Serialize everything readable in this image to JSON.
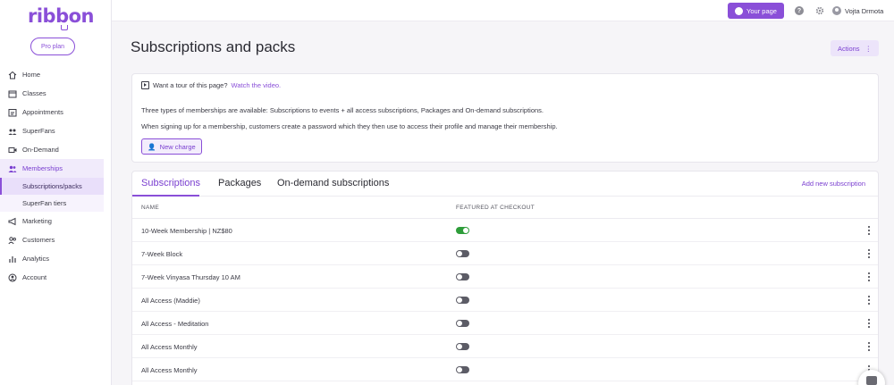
{
  "brand": {
    "logo": "ribbon",
    "accent": "#8a4fd8",
    "plan_label": "Pro plan"
  },
  "topbar": {
    "your_page_label": "Your page",
    "user_name": "Vojta Drmota"
  },
  "sidebar": {
    "items": [
      {
        "label": "Home",
        "icon": "home-icon"
      },
      {
        "label": "Classes",
        "icon": "calendar-icon"
      },
      {
        "label": "Appointments",
        "icon": "appointments-icon"
      },
      {
        "label": "SuperFans",
        "icon": "superfans-icon"
      },
      {
        "label": "On-Demand",
        "icon": "video-icon"
      },
      {
        "label": "Memberships",
        "icon": "members-icon",
        "active": true
      },
      {
        "label": "Marketing",
        "icon": "megaphone-icon"
      },
      {
        "label": "Customers",
        "icon": "customers-icon"
      },
      {
        "label": "Analytics",
        "icon": "analytics-icon"
      },
      {
        "label": "Account",
        "icon": "account-icon"
      }
    ],
    "sub_items": [
      {
        "label": "Subscriptions/packs",
        "active": true
      },
      {
        "label": "SuperFan tiers"
      }
    ]
  },
  "main": {
    "title": "Subscriptions and packs",
    "actions_label": "Actions",
    "info": {
      "tour_text": "Want a tour of this page?",
      "tour_link": "Watch the video.",
      "text1": "Three types of memberships are available: Subscriptions to events + all access subscriptions, Packages and On-demand subscriptions.",
      "text2": "When signing up for a membership, customers create a password which they then use to access their profile and manage their membership.",
      "new_charge_label": "New charge"
    },
    "tabs": [
      "Subscriptions",
      "Packages",
      "On-demand subscriptions"
    ],
    "add_new_label": "Add new subscription",
    "columns": [
      "NAME",
      "FEATURED AT CHECKOUT"
    ],
    "rows": [
      {
        "name": "10-Week Membership | NZ$80",
        "featured": true
      },
      {
        "name": "7-Week Block",
        "featured": false
      },
      {
        "name": "7-Week Vinyasa Thursday 10 AM",
        "featured": false
      },
      {
        "name": "All Access (Maddie)",
        "featured": false
      },
      {
        "name": "All Access - Meditation",
        "featured": false
      },
      {
        "name": "All Access Monthly",
        "featured": false
      },
      {
        "name": "All Access Monthly",
        "featured": false
      }
    ]
  }
}
